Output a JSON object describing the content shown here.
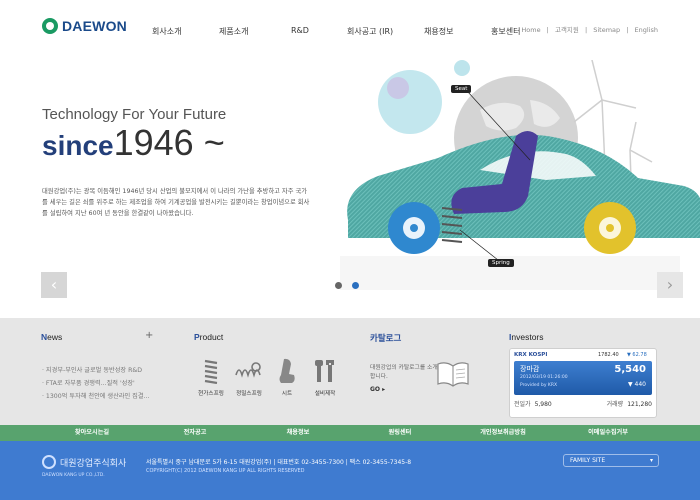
{
  "header": {
    "logo_text": "DAEWON",
    "nav": [
      "회사소개",
      "제품소개",
      "R&D",
      "회사공고 (IR)",
      "채용정보",
      "홍보센터"
    ],
    "util": [
      "Home",
      "|",
      "고객지원",
      "|",
      "Sitemap",
      "|",
      "English"
    ]
  },
  "hero": {
    "tagline": "Technology For Your Future",
    "since_word": "since",
    "since_year": "1946 ~",
    "description": "대원강업(주)는 광복 이듬해인 1946년 당시 산업의 불모지에서 이 나라의 가난을 추방하고 자주 국가를 세우는 길은 쇠를 위주로 하는 제조업을 하여 기계공업을 발전시키는 길뿐이라는 창업이념으로 회사를 설립하여 지난 60여 년 동안을 한결같이 나아왔습니다.",
    "callouts": {
      "seat": "Seat",
      "spring": "Spring"
    },
    "arrow_left": "‹",
    "arrow_right": "›"
  },
  "news": {
    "title_first": "N",
    "title_rest": "ews",
    "plus": "+",
    "items": [
      "· 지경부-부인사 글로벌 동반성장 R&D",
      "· FTA로 자부품 경쟁력...질적 '성장'",
      "· 1300억 투자해 천안에 생산라인 집결..."
    ]
  },
  "product": {
    "title_first": "P",
    "title_rest": "roduct",
    "items": [
      "현가스프링",
      "정밀스프링",
      "시트",
      "설비제작"
    ]
  },
  "catalog": {
    "title": "카탈로그",
    "description": "대원강업의 카탈로그를 소개합니다.",
    "go": "GO ▸"
  },
  "investors": {
    "title_first": "I",
    "title_rest": "nvestors",
    "kospi_label": "KRX KOSPI",
    "kospi_value": "1782.40",
    "kospi_change": "▼ 62.78",
    "market_label": "장마감",
    "date": "2012/03/19 01:26:00",
    "provided_by": "Provided by KRX",
    "price": "5,540",
    "change": "▼ 440",
    "stat_1_label": "전일가",
    "stat_1_value": "5,980",
    "stat_2_label": "거래량",
    "stat_2_value": "121,280"
  },
  "linkbar": [
    "찾아오시는길",
    "전자공고",
    "채용정보",
    "원링센터",
    "개인정보취급방침",
    "이메일수집거부"
  ],
  "footer": {
    "company": "대원강업주식회사",
    "company_eng": "DAEWON KANG UP CO.,LTD.",
    "address": "서울특별시 중구 남대문로 5가 6-15 대원강업(주)  |  대표번호 02-3455-7300  |  팩스 02-3455-7345-8",
    "copyright": "COPYRIGHT(C) 2012 DAEWON KANG UP ALL RIGHTS RESERVED",
    "family_site": "FAMILY SITE",
    "family_chev": "▾"
  },
  "colors": {
    "brand_blue": "#233f7a",
    "accent_blue": "#2a6fbf",
    "car_teal": "#4fa7a2",
    "seat_purple": "#4b3f9a",
    "link_green": "#58a36e",
    "footer_blue": "#3f7bd0"
  }
}
